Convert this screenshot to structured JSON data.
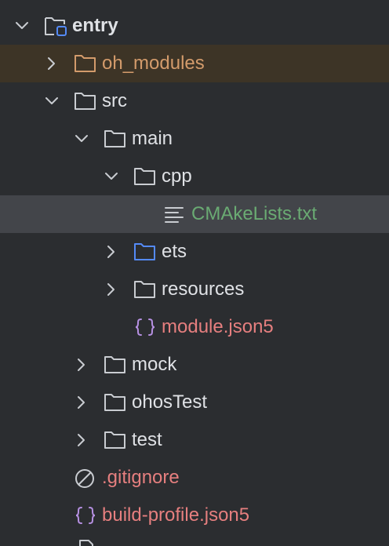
{
  "colors": {
    "background": "#2b2d30",
    "default_text": "#dfe1e5",
    "excluded_text": "#d39b6b",
    "git_added_text": "#6aab73",
    "git_ignored_text": "#e67f7f",
    "folder_blue": "#548af7",
    "json_brace": "#b690e2",
    "excluded_row_bg": "#3d3426",
    "selected_row_bg": "#43454a"
  },
  "tree": {
    "items": [
      {
        "label": "entry",
        "icon": "module-folder-icon",
        "expanded": true
      },
      {
        "label": "oh_modules",
        "icon": "excluded-folder-icon",
        "expanded": false
      },
      {
        "label": "src",
        "icon": "folder-icon",
        "expanded": true
      },
      {
        "label": "main",
        "icon": "folder-icon",
        "expanded": true
      },
      {
        "label": "cpp",
        "icon": "folder-icon",
        "expanded": true
      },
      {
        "label": "CMAkeLists.txt",
        "icon": "text-file-icon",
        "selected": true
      },
      {
        "label": "ets",
        "icon": "source-folder-icon",
        "expanded": false
      },
      {
        "label": "resources",
        "icon": "folder-icon",
        "expanded": false
      },
      {
        "label": "module.json5",
        "icon": "json-file-icon"
      },
      {
        "label": "mock",
        "icon": "folder-icon",
        "expanded": false
      },
      {
        "label": "ohosTest",
        "icon": "folder-icon",
        "expanded": false
      },
      {
        "label": "test",
        "icon": "folder-icon",
        "expanded": false
      },
      {
        "label": ".gitignore",
        "icon": "ignore-file-icon"
      },
      {
        "label": "build-profile.json5",
        "icon": "json-file-icon"
      }
    ]
  }
}
